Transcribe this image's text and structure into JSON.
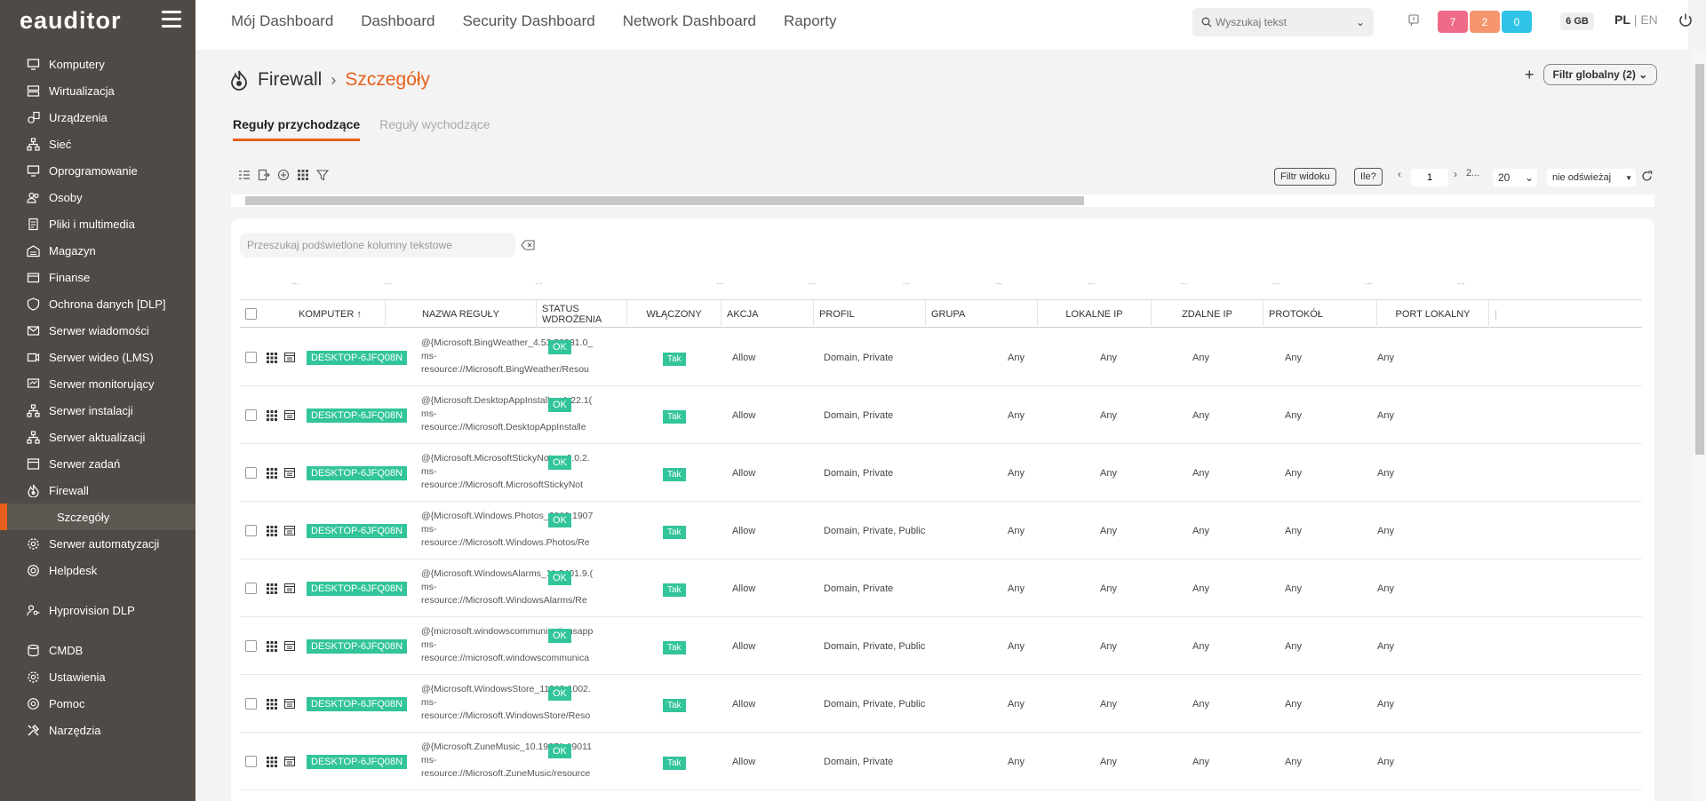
{
  "sidebar": {
    "brand": "eauditor",
    "items": [
      {
        "label": "Komputery",
        "icon": "monitor-icon"
      },
      {
        "label": "Wirtualizacja",
        "icon": "server-icon"
      },
      {
        "label": "Urządzenia",
        "icon": "devices-icon"
      },
      {
        "label": "Sieć",
        "icon": "network-icon"
      },
      {
        "label": "Oprogramowanie",
        "icon": "monitor-icon"
      },
      {
        "label": "Osoby",
        "icon": "people-icon"
      },
      {
        "label": "Pliki i multimedia",
        "icon": "file-icon"
      },
      {
        "label": "Magazyn",
        "icon": "warehouse-icon"
      },
      {
        "label": "Finanse",
        "icon": "wallet-icon"
      },
      {
        "label": "Ochrona danych [DLP]",
        "icon": "shield-icon"
      },
      {
        "label": "Serwer wiadomości",
        "icon": "mail-icon"
      },
      {
        "label": "Serwer wideo (LMS)",
        "icon": "video-icon"
      },
      {
        "label": "Serwer monitorujący",
        "icon": "monitor-chart-icon"
      },
      {
        "label": "Serwer instalacji",
        "icon": "network-icon"
      },
      {
        "label": "Serwer aktualizacji",
        "icon": "network-icon"
      },
      {
        "label": "Serwer zadań",
        "icon": "tasks-icon"
      },
      {
        "label": "Firewall",
        "icon": "firewall-icon"
      },
      {
        "label": "Szczegóły",
        "icon": ""
      },
      {
        "label": "Serwer automatyzacji",
        "icon": "gear-icon"
      },
      {
        "label": "Helpdesk",
        "icon": "helpdesk-icon"
      },
      {
        "label": "Hyprovision DLP",
        "icon": "user-key-icon"
      },
      {
        "label": "CMDB",
        "icon": "database-icon"
      },
      {
        "label": "Ustawienia",
        "icon": "gear-icon"
      },
      {
        "label": "Pomoc",
        "icon": "help-icon"
      },
      {
        "label": "Narzędzia",
        "icon": "tools-icon"
      }
    ]
  },
  "topnav": [
    "Mój Dashboard",
    "Dashboard",
    "Security Dashboard",
    "Network Dashboard",
    "Raporty"
  ],
  "search": {
    "placeholder": "Wyszukaj tekst"
  },
  "badges": [
    {
      "value": "7",
      "color": "#ee6a86"
    },
    {
      "value": "2",
      "color": "#f5966f"
    },
    {
      "value": "0",
      "color": "#2fc4e6"
    }
  ],
  "memory": "6 GB",
  "lang": {
    "pl": "PL",
    "sep": " | ",
    "en": "EN"
  },
  "breadcrumb": {
    "section": "Firewall",
    "current": "Szczegóły"
  },
  "global_filter": {
    "plus": "+",
    "label": "Filtr globalny (2)"
  },
  "tabs": [
    "Reguły przychodzące",
    "Reguły wychodzące"
  ],
  "toolbar": {
    "view_filter": "Filtr widoku",
    "count": "Ile?",
    "page": "1",
    "page_next": "2...",
    "per_page": "20",
    "refresh": "nie odświeżaj"
  },
  "table_search_placeholder": "Przeszukaj podświetlone kolumny tekstowe",
  "columns": [
    "KOMPUTER",
    "NAZWA REGUŁY",
    "STATUS WDROŻENIA",
    "WŁĄCZONY",
    "AKCJA",
    "PROFIL",
    "GRUPA",
    "LOKALNE IP",
    "ZDALNE IP",
    "PROTOKÓŁ",
    "PORT LOKALNY"
  ],
  "rows": [
    {
      "computer": "DESKTOP-6JFQ08N",
      "name1": "@{Microsoft.BingWeather_4.53.52331.0_",
      "name2": "ms-",
      "name3": "resource://Microsoft.BingWeather/Resou",
      "status": "OK",
      "enabled": "Tak",
      "action": "Allow",
      "profile": "Domain, Private",
      "local_ip": "Any",
      "remote_ip": "Any",
      "protocol": "Any",
      "port_local": "Any",
      "extra": "Any"
    },
    {
      "computer": "DESKTOP-6JFQ08N",
      "name1": "@{Microsoft.DesktopAppInstaller_1.22.1(",
      "name2": "ms-",
      "name3": "resource://Microsoft.DesktopAppInstalle",
      "status": "OK",
      "enabled": "Tak",
      "action": "Allow",
      "profile": "Domain, Private",
      "local_ip": "Any",
      "remote_ip": "Any",
      "protocol": "Any",
      "port_local": "Any",
      "extra": "Any"
    },
    {
      "computer": "DESKTOP-6JFQ08N",
      "name1": "@{Microsoft.MicrosoftStickyNotes_6.0.2.",
      "name2": "ms-",
      "name3": "resource://Microsoft.MicrosoftStickyNot",
      "status": "OK",
      "enabled": "Tak",
      "action": "Allow",
      "profile": "Domain, Private",
      "local_ip": "Any",
      "remote_ip": "Any",
      "protocol": "Any",
      "port_local": "Any",
      "extra": "Any"
    },
    {
      "computer": "DESKTOP-6JFQ08N",
      "name1": "@{Microsoft.Windows.Photos_2019.1907",
      "name2": "ms-",
      "name3": "resource://Microsoft.Windows.Photos/Re",
      "status": "OK",
      "enabled": "Tak",
      "action": "Allow",
      "profile": "Domain, Private, Public",
      "local_ip": "Any",
      "remote_ip": "Any",
      "protocol": "Any",
      "port_local": "Any",
      "extra": "Any"
    },
    {
      "computer": "DESKTOP-6JFQ08N",
      "name1": "@{Microsoft.WindowsAlarms_11.2401.9.(",
      "name2": "ms-",
      "name3": "resource://Microsoft.WindowsAlarms/Re",
      "status": "OK",
      "enabled": "Tak",
      "action": "Allow",
      "profile": "Domain, Private",
      "local_ip": "Any",
      "remote_ip": "Any",
      "protocol": "Any",
      "port_local": "Any",
      "extra": "Any"
    },
    {
      "computer": "DESKTOP-6JFQ08N",
      "name1": "@{microsoft.windowscommunicationsapp",
      "name2": "ms-",
      "name3": "resource://microsoft.windowscommunica",
      "status": "OK",
      "enabled": "Tak",
      "action": "Allow",
      "profile": "Domain, Private, Public",
      "local_ip": "Any",
      "remote_ip": "Any",
      "protocol": "Any",
      "port_local": "Any",
      "extra": "Any"
    },
    {
      "computer": "DESKTOP-6JFQ08N",
      "name1": "@{Microsoft.WindowsStore_11910.1002.",
      "name2": "ms-",
      "name3": "resource://Microsoft.WindowsStore/Reso",
      "status": "OK",
      "enabled": "Tak",
      "action": "Allow",
      "profile": "Domain, Private, Public",
      "local_ip": "Any",
      "remote_ip": "Any",
      "protocol": "Any",
      "port_local": "Any",
      "extra": "Any"
    },
    {
      "computer": "DESKTOP-6JFQ08N",
      "name1": "@{Microsoft.ZuneMusic_10.19071.19011",
      "name2": "ms-",
      "name3": "resource://Microsoft.ZuneMusic/resource",
      "status": "OK",
      "enabled": "Tak",
      "action": "Allow",
      "profile": "Domain, Private",
      "local_ip": "Any",
      "remote_ip": "Any",
      "protocol": "Any",
      "port_local": "Any",
      "extra": "Any"
    }
  ]
}
